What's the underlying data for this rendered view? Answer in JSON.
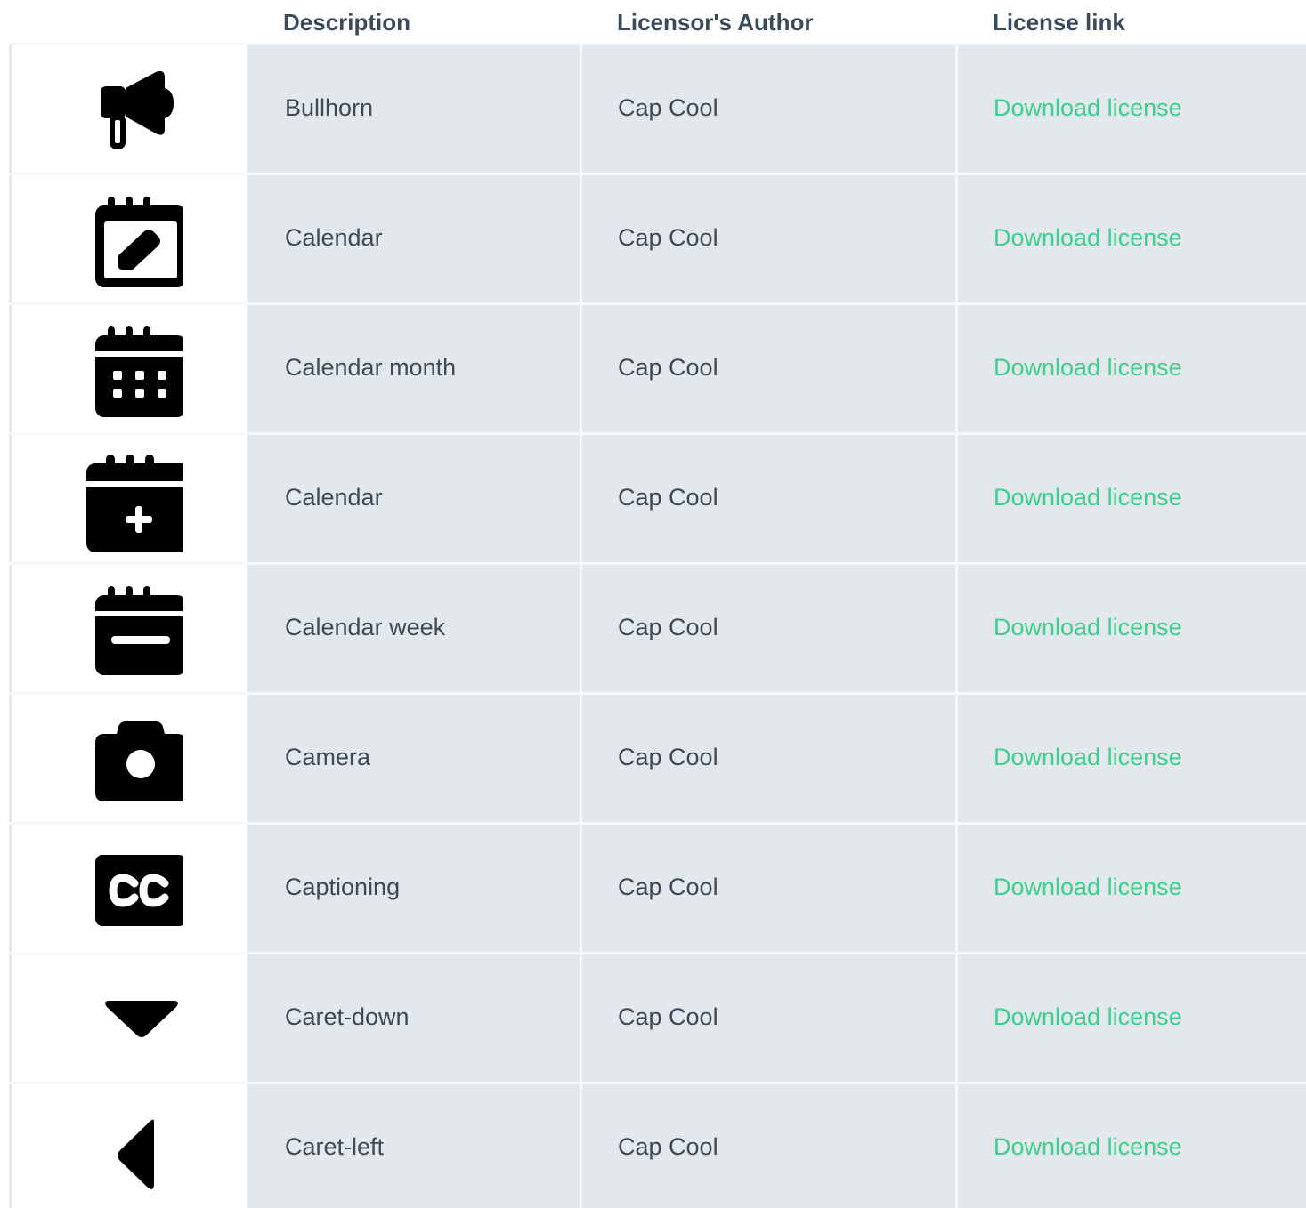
{
  "columns": {
    "description": "Description",
    "author": "Licensor's Author",
    "link": "License link"
  },
  "rows": [
    {
      "icon": "bullhorn-icon",
      "description": "Bullhorn",
      "author": "Cap Cool",
      "link": "Download license"
    },
    {
      "icon": "calendar-edit-icon",
      "description": "Calendar",
      "author": "Cap Cool",
      "link": "Download license"
    },
    {
      "icon": "calendar-month-icon",
      "description": "Calendar month",
      "author": "Cap Cool",
      "link": "Download license"
    },
    {
      "icon": "calendar-plus-icon",
      "description": "Calendar",
      "author": "Cap Cool",
      "link": "Download license"
    },
    {
      "icon": "calendar-week-icon",
      "description": "Calendar week",
      "author": "Cap Cool",
      "link": "Download license"
    },
    {
      "icon": "camera-icon",
      "description": "Camera",
      "author": "Cap Cool",
      "link": "Download license"
    },
    {
      "icon": "captioning-icon",
      "description": "Captioning",
      "author": "Cap Cool",
      "link": "Download license"
    },
    {
      "icon": "caret-down-icon",
      "description": "Caret-down",
      "author": "Cap Cool",
      "link": "Download license"
    },
    {
      "icon": "caret-left-icon",
      "description": "Caret-left",
      "author": "Cap Cool",
      "link": "Download license"
    }
  ],
  "colors": {
    "header_text": "#3a4a5a",
    "body_text": "#3d4b59",
    "link": "#3ecf8e",
    "cell_bg": "#e3e8ec",
    "icon_bg": "#ffffff"
  }
}
